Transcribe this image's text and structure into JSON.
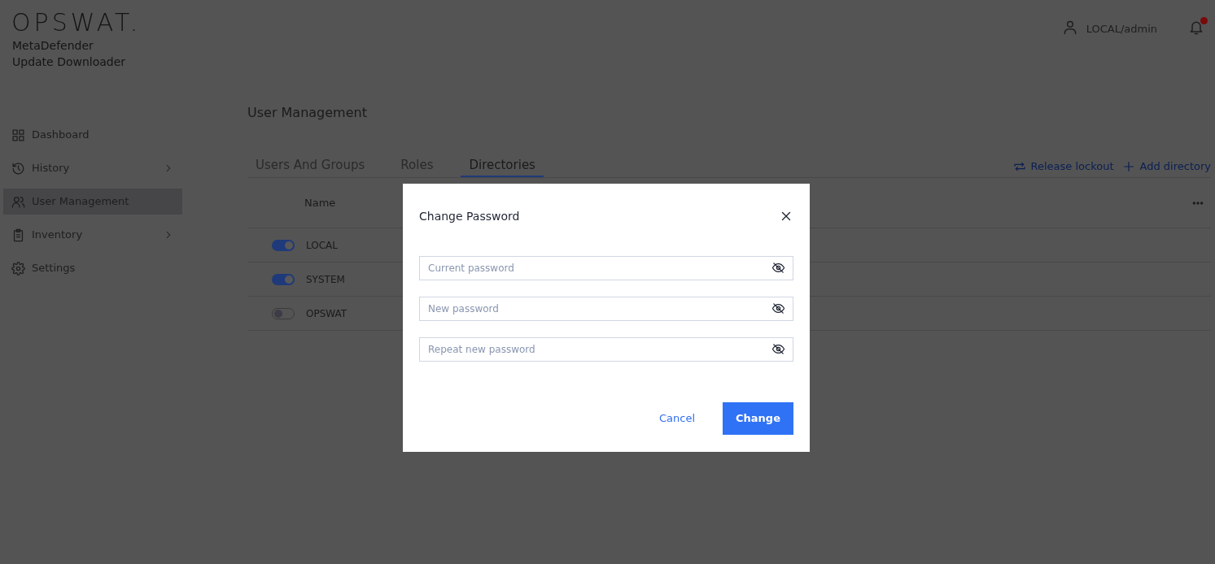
{
  "brand": {
    "logo": "OPSWAT.",
    "product_line_1": "MetaDefender",
    "product_line_2": "Update Downloader"
  },
  "header": {
    "user": "LOCAL/admin",
    "notification_dot": true
  },
  "sidebar": {
    "items": [
      {
        "label": "Dashboard",
        "has_submenu": false,
        "selected": false
      },
      {
        "label": "History",
        "has_submenu": true,
        "selected": false
      },
      {
        "label": "User Management",
        "has_submenu": false,
        "selected": true
      },
      {
        "label": "Inventory",
        "has_submenu": true,
        "selected": false
      },
      {
        "label": "Settings",
        "has_submenu": false,
        "selected": false
      }
    ]
  },
  "page_title": "User Management",
  "tabs": [
    {
      "label": "Users And Groups",
      "selected": false
    },
    {
      "label": "Roles",
      "selected": false
    },
    {
      "label": "Directories",
      "selected": true
    }
  ],
  "actions": [
    {
      "label": "Release lockout"
    },
    {
      "label": "Add directory"
    }
  ],
  "table": {
    "columns": [
      "Name"
    ],
    "rows": [
      {
        "name": "LOCAL",
        "enabled": true
      },
      {
        "name": "SYSTEM",
        "enabled": true
      },
      {
        "name": "OPSWAT",
        "enabled": false
      }
    ]
  },
  "dialog": {
    "title": "Change Password",
    "fields": [
      {
        "placeholder": "Current password"
      },
      {
        "placeholder": "New password"
      },
      {
        "placeholder": "Repeat new password"
      }
    ],
    "cancel": "Cancel",
    "confirm": "Change"
  }
}
